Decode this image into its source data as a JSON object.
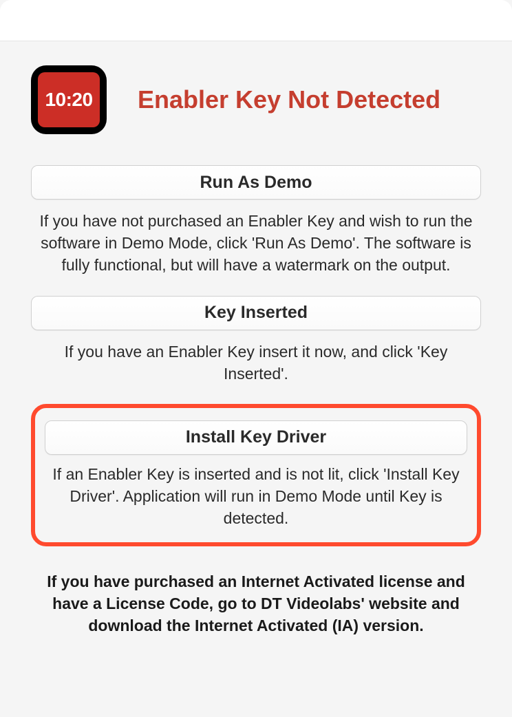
{
  "icon": {
    "time_display": "10:20"
  },
  "title": "Enabler Key Not Detected",
  "sections": {
    "run_as_demo": {
      "button_label": "Run As Demo",
      "description": "If you have not purchased an Enabler Key and wish to run the software in Demo Mode, click 'Run As Demo'. The software is fully functional, but will have a watermark on the output."
    },
    "key_inserted": {
      "button_label": "Key Inserted",
      "description": "If you have an Enabler Key insert it now, and click 'Key Inserted'."
    },
    "install_driver": {
      "button_label": "Install Key Driver",
      "description": "If an Enabler Key is inserted and is not lit, click 'Install Key Driver'.  Application will run in Demo Mode until Key is detected."
    }
  },
  "footer": "If you have purchased an Internet Activated license and have a License Code, go to DT Videolabs' website and download the Internet Activated (IA) version."
}
